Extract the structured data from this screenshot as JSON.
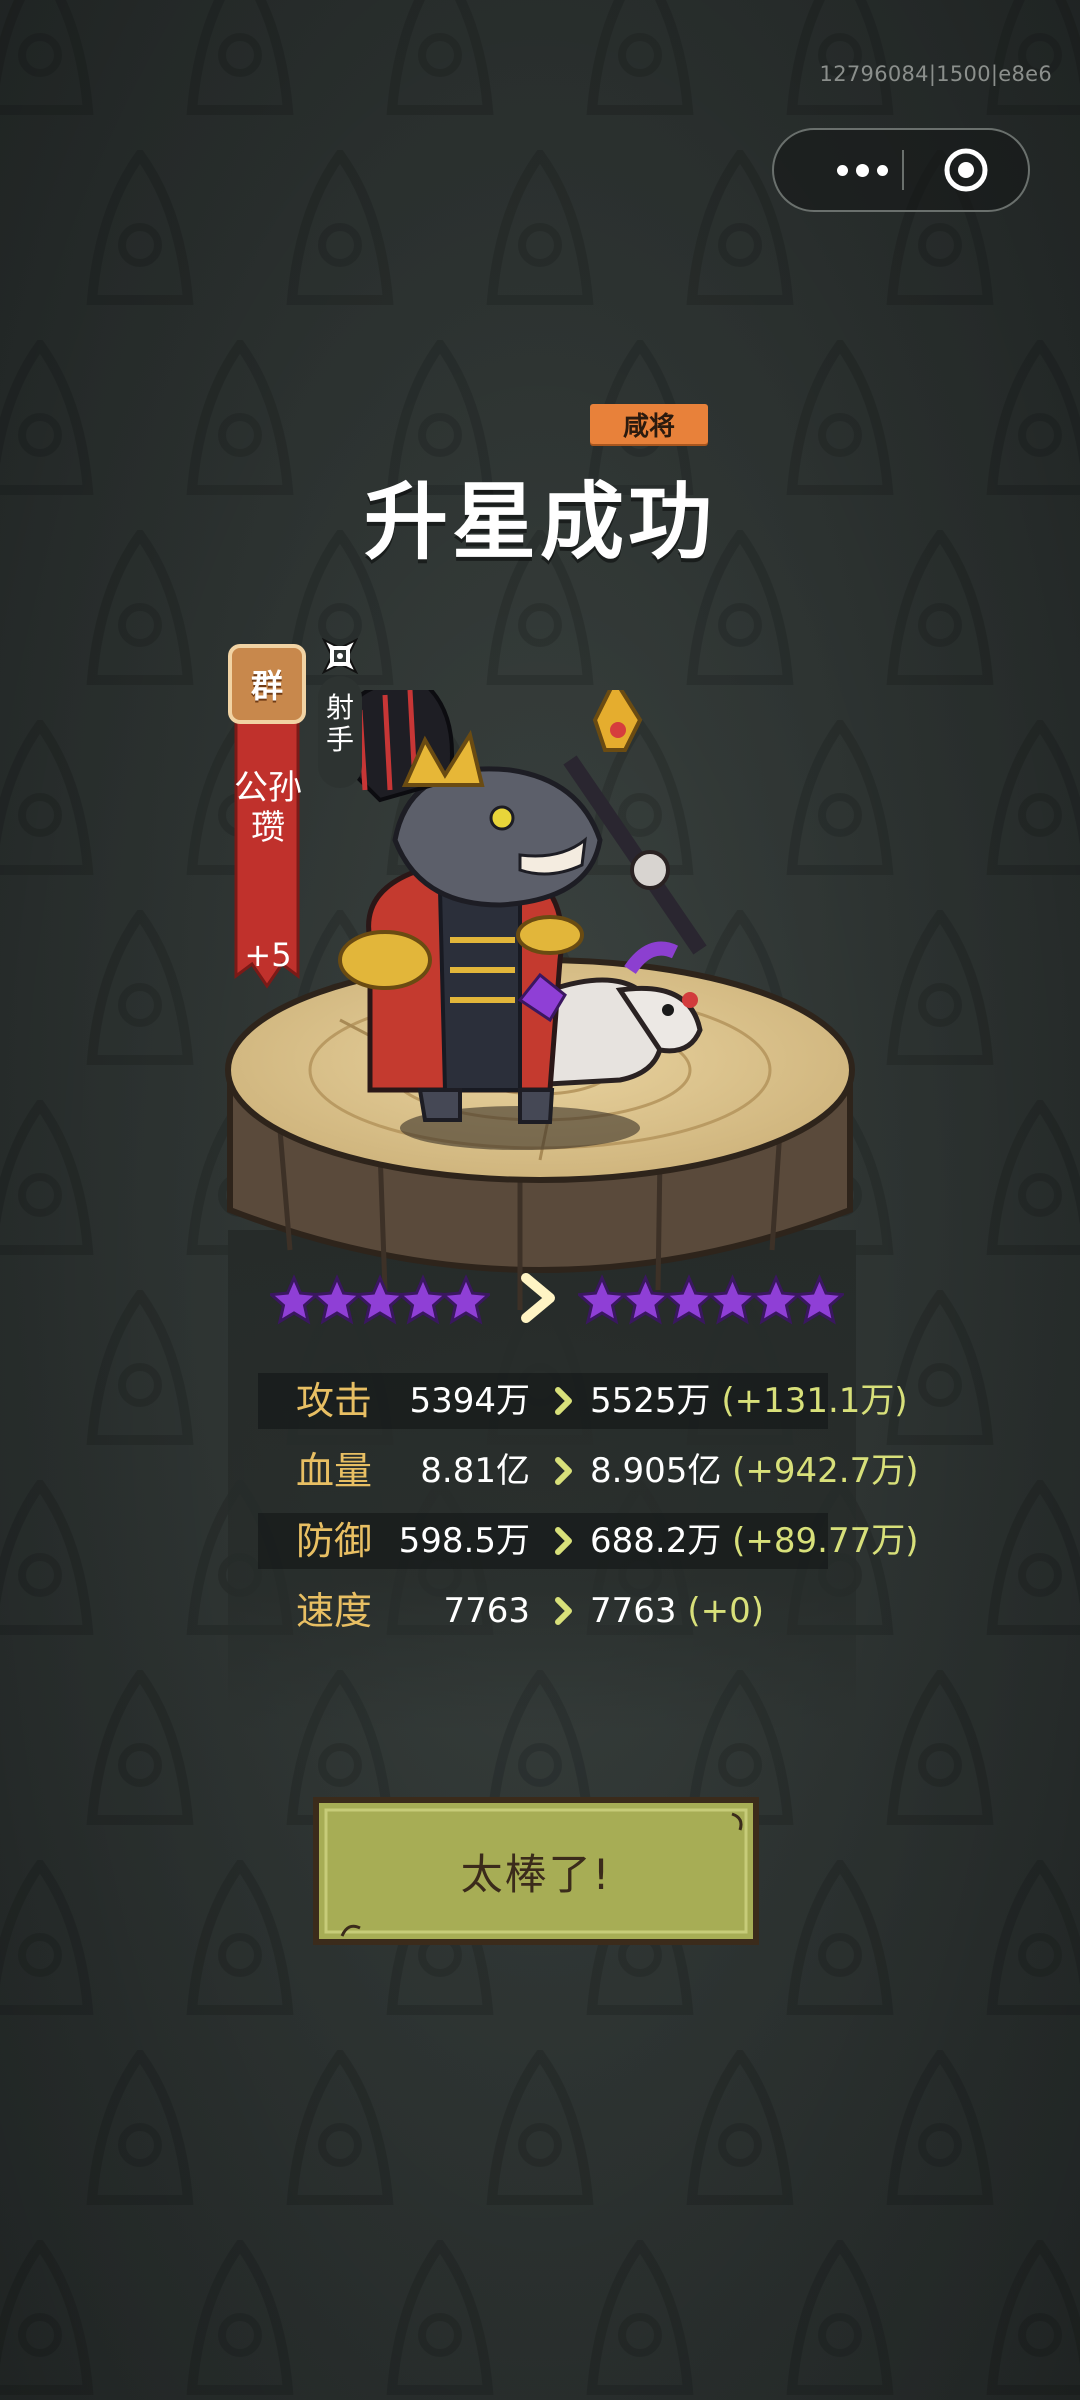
{
  "system": {
    "build_id": "12796084|1500|e8e6",
    "capsule": {
      "more_icon": "more-dots-icon",
      "close_icon": "mini-program-close-icon"
    }
  },
  "result": {
    "tag": "咸将",
    "title": "升星成功"
  },
  "hero": {
    "faction": "群",
    "name": "公孙瓒",
    "level_bonus": "+5",
    "role": "射手",
    "role_icon": "archer-crosshair-icon",
    "portrait": "shark-king-on-horse-illustration"
  },
  "stars": {
    "before": 5,
    "after": 6,
    "star_color": "#8f3fd6"
  },
  "stats": [
    {
      "label": "攻击",
      "old": "5394万",
      "new": "5525万",
      "delta": "(+131.1万)"
    },
    {
      "label": "血量",
      "old": "8.81亿",
      "new": "8.905亿",
      "delta": "(+942.7万)"
    },
    {
      "label": "防御",
      "old": "598.5万",
      "new": "688.2万",
      "delta": "(+89.77万)"
    },
    {
      "label": "速度",
      "old": "7763",
      "new": "7763",
      "delta": "(+0)"
    }
  ],
  "confirm_button": {
    "label": "太棒了!"
  },
  "colors": {
    "stat_label": "#e8bf63",
    "delta": "#d8e07a",
    "tag_bg": "#e8813a",
    "banner_red": "#c0312c",
    "button_bg": "#a7ad55"
  }
}
